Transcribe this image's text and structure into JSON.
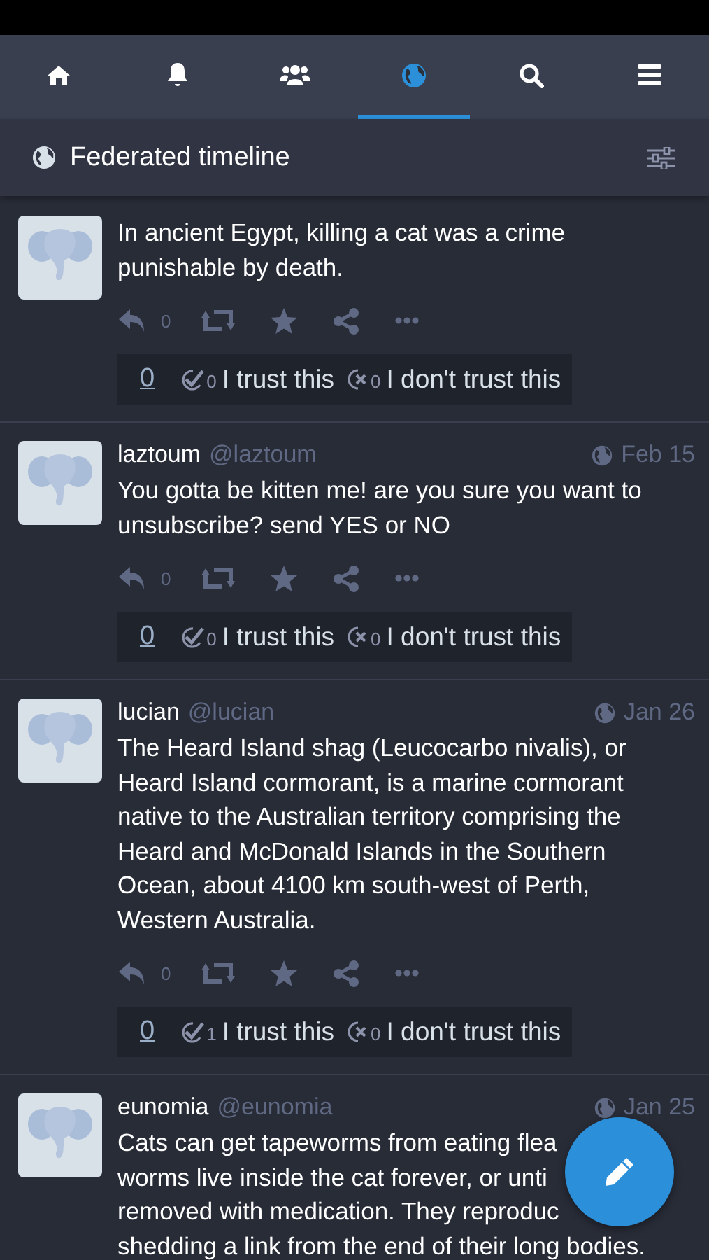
{
  "nav": {
    "tabs": [
      {
        "selected": false
      },
      {
        "selected": false
      },
      {
        "selected": false
      },
      {
        "selected": true
      },
      {
        "selected": false
      },
      {
        "selected": false
      }
    ]
  },
  "column_header": {
    "title": "Federated timeline"
  },
  "posts": [
    {
      "content_lines": [
        "In ancient Egypt, killing a cat was a crime punishable by death."
      ],
      "reply_count": "0",
      "trust": {
        "score": "0",
        "trusts": "0",
        "trust_label": "I trust this",
        "distrusts": "0",
        "distrust_label": "I don't trust this"
      }
    },
    {
      "name": "laztoum",
      "handle": "@laztoum",
      "date": "Feb 15",
      "content_lines": [
        "You gotta be kitten me! are you sure you want to unsubscribe? send YES or NO"
      ],
      "reply_count": "0",
      "trust": {
        "score": "0",
        "trusts": "0",
        "trust_label": "I trust this",
        "distrusts": "0",
        "distrust_label": "I don't trust this"
      }
    },
    {
      "name": "lucian",
      "handle": "@lucian",
      "date": "Jan 26",
      "content_lines": [
        "The Heard Island shag (Leucocarbo nivalis), or Heard Island cormorant, is a marine cormorant native to the Australian territory comprising the Heard and McDonald Islands in the Southern Ocean, about 4100 km south-west of Perth, Western Australia."
      ],
      "reply_count": "0",
      "trust": {
        "score": "0",
        "trusts": "1",
        "trust_label": "I trust this",
        "distrusts": "0",
        "distrust_label": "I don't trust this"
      }
    },
    {
      "name": "eunomia",
      "handle": "@eunomia",
      "date": "Jan 25",
      "content_lines": [
        "Cats can get tapeworms from eating flea",
        "worms live inside the cat forever, or unti",
        "removed with medication. They reproduc",
        "shedding a link from the end of their long bodies."
      ]
    }
  ]
}
